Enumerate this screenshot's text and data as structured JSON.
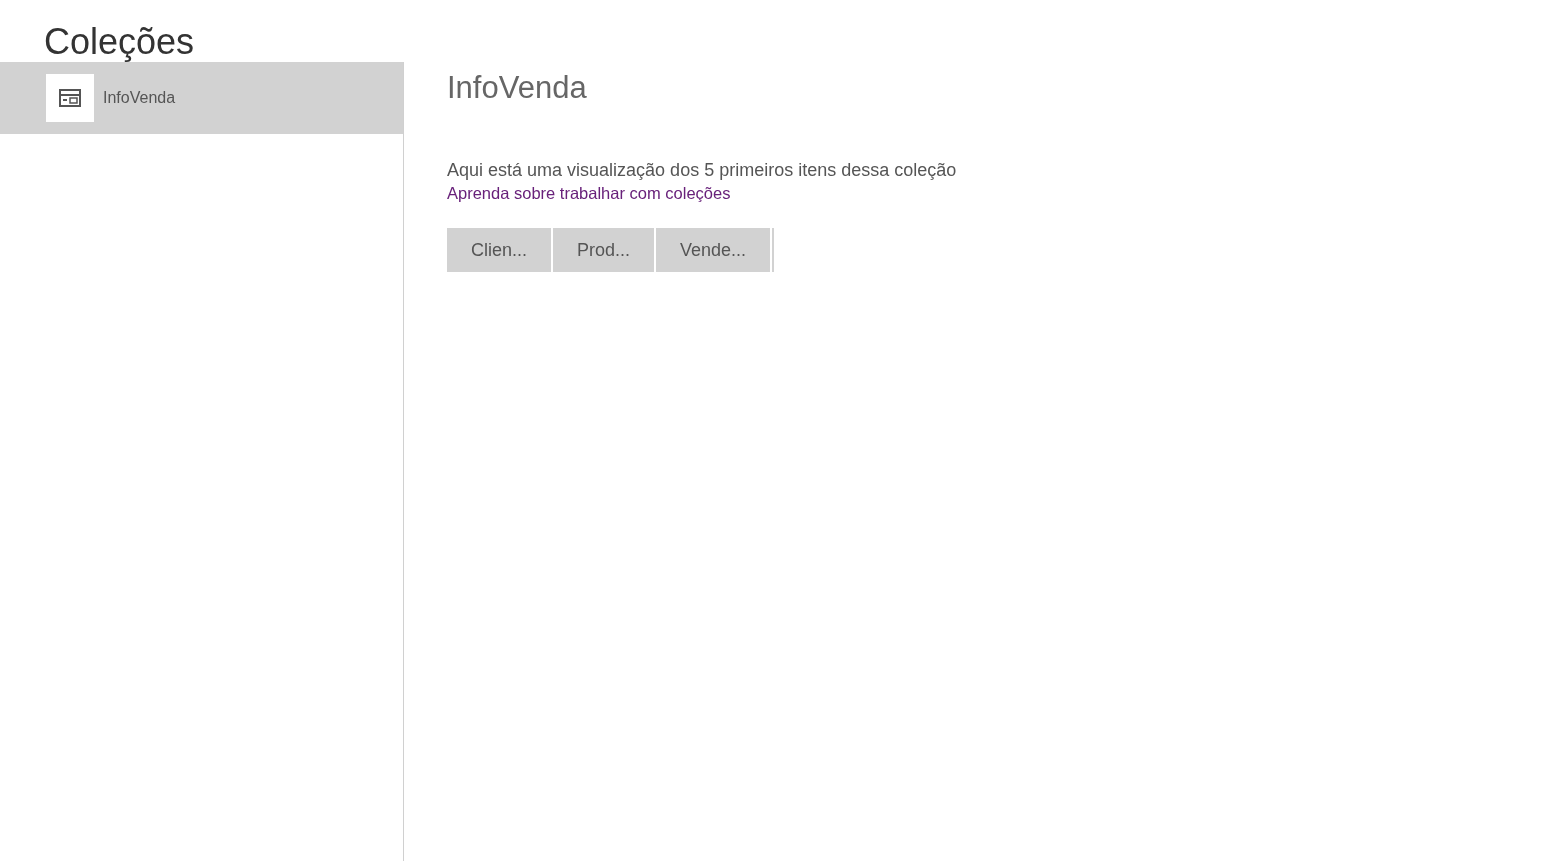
{
  "title": "Coleções",
  "sidebar": {
    "items": [
      {
        "label": "InfoVenda",
        "selected": true
      }
    ]
  },
  "detail": {
    "heading": "InfoVenda",
    "description": "Aqui está uma visualização dos 5 primeiros itens dessa coleção",
    "link": "Aprenda sobre trabalhar com coleções",
    "table": {
      "columns": [
        "Clien...",
        "Prod...",
        "Vende..."
      ]
    }
  }
}
